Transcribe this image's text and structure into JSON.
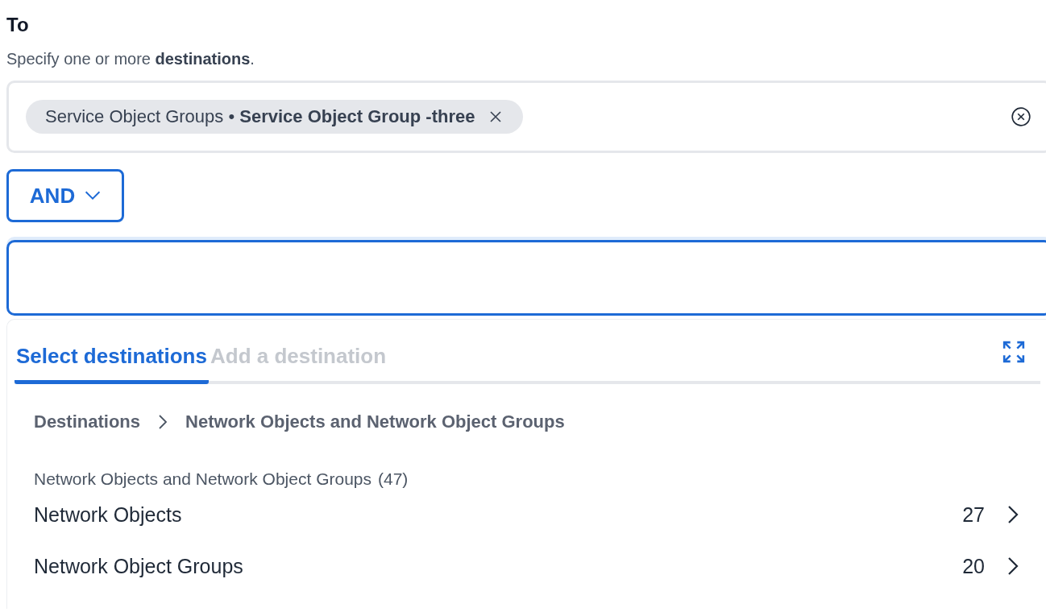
{
  "heading": "To",
  "description": "Specify one or more **destinations**.",
  "selected_chips": [
    {
      "label": "Service Object Groups • **Service Object Group -three**"
    }
  ],
  "operator": {
    "label": "AND"
  },
  "search": {
    "focused": true
  },
  "dropdown": {
    "tabs": [
      {
        "label": "Select destinations",
        "selected": true
      },
      {
        "label": "Add a destination",
        "selected": false
      }
    ],
    "breadcrumb": [
      "Destinations",
      "Network Objects and Network Object Groups"
    ],
    "section": {
      "title": "Network Objects and Network Object Groups",
      "count": "(47)"
    },
    "items": [
      {
        "label": "Network Objects",
        "count": "27"
      },
      {
        "label": "Network Object Groups",
        "count": "20"
      }
    ]
  }
}
